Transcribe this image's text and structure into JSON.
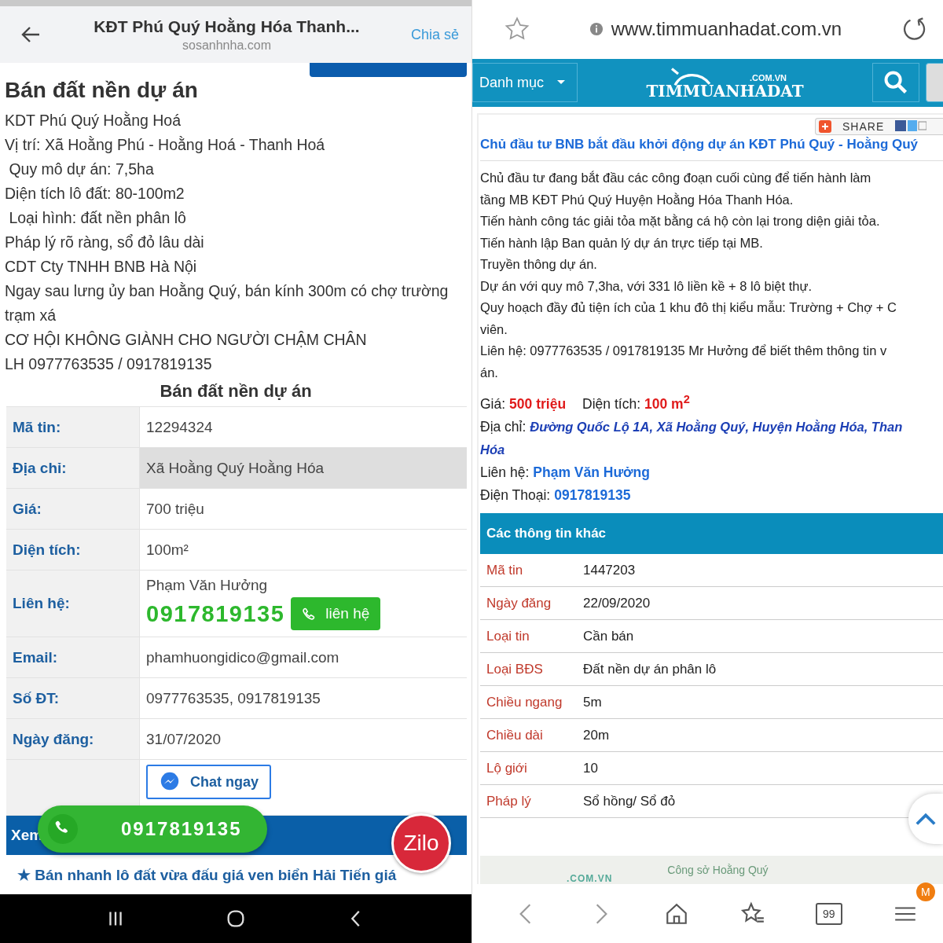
{
  "left": {
    "header": {
      "title": "KĐT Phú Quý Hoằng Hóa Thanh...",
      "site": "sosanhnha.com",
      "share": "Chia sẻ"
    },
    "heading": "Bán đất nền dự án",
    "description": [
      "KDT Phú Quý Hoằng Hoá",
      "Vị trí: Xã Hoằng Phú - Hoằng Hoá - Thanh Hoá",
      " Quy mô dự án: 7,5ha",
      "Diện tích lô đất: 80-100m2",
      " Loại hình: đất nền phân lô",
      "Pháp lý rõ ràng, sổ đỏ lâu dài",
      "CDT Cty TNHH BNB Hà Nội",
      "Ngay sau lưng ủy ban Hoằng Quý, bán kính 300m có chợ trường trạm xá",
      "CƠ HỘI KHÔNG GIÀNH CHO NGƯỜI CHẬM CHÂN",
      "LH 0977763535 / 0917819135"
    ],
    "table_title": "Bán đất nền dự án",
    "rows": [
      {
        "kind": "text",
        "label": "Mã tin:",
        "value": "12294324",
        "highlighted": false
      },
      {
        "kind": "text",
        "label": "Địa chỉ:",
        "value": "Xã Hoằng Quý Hoằng Hóa",
        "highlighted": true
      },
      {
        "kind": "text",
        "label": "Giá:",
        "value": "700 triệu",
        "highlighted": false
      },
      {
        "kind": "text",
        "label": "Diện tích:",
        "value": "100m²",
        "highlighted": false
      },
      {
        "kind": "contact",
        "label": "Liên hệ:",
        "value": "Phạm Văn Hưởng",
        "phone": "0917819135",
        "button": "liên hệ",
        "highlighted": false
      },
      {
        "kind": "text",
        "label": "Email:",
        "value": "phamhuongidico@gmail.com",
        "highlighted": false
      },
      {
        "kind": "text",
        "label": "Số ĐT:",
        "value": "0977763535, 0917819135",
        "highlighted": false
      },
      {
        "kind": "text",
        "label": "Ngày đăng:",
        "value": "31/07/2020",
        "highlighted": false
      },
      {
        "kind": "chat",
        "button": "Chat ngay",
        "highlighted": false
      }
    ],
    "related_bar": "Xem",
    "related_link": "★ Bán nhanh lô đất vừa đấu giá ven biển Hải Tiến giá",
    "float_call": "0917819135",
    "zilo": "Zilo"
  },
  "right": {
    "url": "www.timmuanhadat.com.vn",
    "menu": "Danh mục",
    "logo": {
      "domain": ".COM.VN",
      "name": "TIMMUANHADAT"
    },
    "share": "SHARE",
    "title": "Chủ đầu tư BNB bắt đầu khởi động dự án KĐT Phú Quý - Hoằng Quý",
    "body": [
      "Chủ đầu tư đang bắt đầu các công đoạn cuối cùng để tiến hành làm",
      "tầng MB KĐT Phú Quý Huyện Hoằng Hóa Thanh Hóa.",
      "Tiến hành công tác giải tỏa mặt bằng cá hộ còn lại trong diện giải tỏa.",
      "Tiến hành lập Ban quản lý dự án trực tiếp tại MB.",
      "Truyền thông dự án.",
      "Dự án với quy mô 7,3ha, với 331 lô liền kề + 8 lô biệt thự.",
      "Quy hoạch đầy đủ tiện ích của 1 khu đô thị kiểu mẫu: Trường + Chợ + C",
      "viên.",
      "Liên hệ: 0977763535 / 0917819135 Mr Hưởng để biết thêm thông tin v",
      "án."
    ],
    "price": {
      "label": "Giá:",
      "value": "500 triệu"
    },
    "area": {
      "label": "Diện tích:",
      "value": "100 m$^{2}$"
    },
    "address": {
      "label": "Địa chỉ:",
      "lines": [
        "Đường Quốc Lộ 1A, Xã Hoằng Quý, Huyện Hoằng Hóa, Than",
        "Hóa"
      ]
    },
    "contact": {
      "label": "Liên hệ:",
      "value": "Phạm Văn Hưởng"
    },
    "phone": {
      "label": "Điện Thoại:",
      "value": "0917819135"
    },
    "info_title": "Các thông tin khác",
    "info": [
      {
        "label": "Mã tin",
        "value": "1447203"
      },
      {
        "label": "Ngày đăng",
        "value": "22/09/2020"
      },
      {
        "label": "Loại tin",
        "value": "Cần bán"
      },
      {
        "label": "Loại BĐS",
        "value": "Đất nền dự án phân lô"
      },
      {
        "label": "Chiều ngang",
        "value": "5m"
      },
      {
        "label": "Chiều dài",
        "value": "20m"
      },
      {
        "label": "Lộ giới",
        "value": "10"
      },
      {
        "label": "Pháp lý",
        "value": "Sổ hồng/ Sổ đỏ"
      }
    ],
    "banner": {
      "domain": ".COM.VN",
      "caption": "Công sở Hoằng Quý"
    },
    "tab_count": "99",
    "menu_badge": "M"
  }
}
